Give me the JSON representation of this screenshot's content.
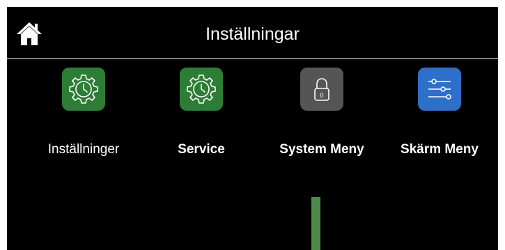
{
  "header": {
    "title": "Inställningar",
    "home_icon": "home-icon"
  },
  "tiles": [
    {
      "label": "Inställninger",
      "icon": "gear-clock-icon",
      "color": "#2e7d36"
    },
    {
      "label": "Service",
      "icon": "gear-clock-icon",
      "color": "#2e7d36"
    },
    {
      "label": "System Meny",
      "icon": "lock-icon",
      "color": "#555555",
      "lock_text": "0"
    },
    {
      "label": "Skärm Meny",
      "icon": "sliders-icon",
      "color": "#2e6fc9"
    }
  ],
  "colors": {
    "background": "#000000",
    "text": "#ffffff",
    "green_tile": "#2e7d36",
    "gray_tile": "#555555",
    "blue_tile": "#2e6fc9",
    "bar": "#4f8a4a"
  }
}
